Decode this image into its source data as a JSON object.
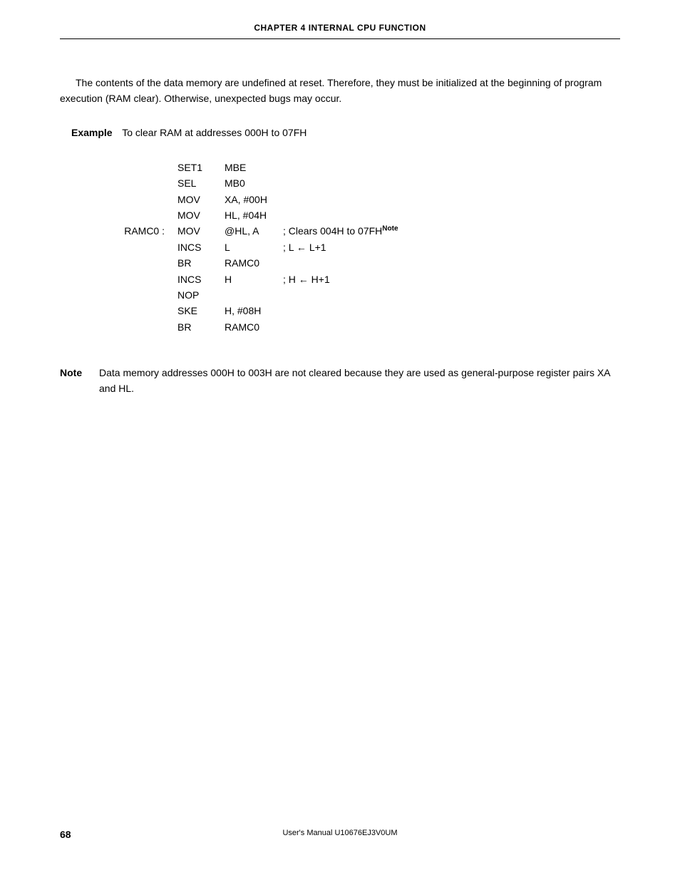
{
  "header": {
    "chapter": "CHAPTER 4   INTERNAL CPU FUNCTION"
  },
  "paragraph1": "The contents of the data memory are undefined at reset.  Therefore, they must be initialized at the beginning of program execution (RAM clear).  Otherwise, unexpected bugs may occur.",
  "example": {
    "label": "Example",
    "text": "To clear RAM at addresses 000H to 07FH"
  },
  "code": {
    "rows": [
      {
        "label": "",
        "op": "SET1",
        "arg": "MBE",
        "comment": ""
      },
      {
        "label": "",
        "op": "SEL",
        "arg": "MB0",
        "comment": ""
      },
      {
        "label": "",
        "op": "MOV",
        "arg": "XA, #00H",
        "comment": ""
      },
      {
        "label": "",
        "op": "MOV",
        "arg": "HL, #04H",
        "comment": ""
      },
      {
        "label": "RAMC0 :",
        "op": "MOV",
        "arg": "@HL, A",
        "comment": "; Clears 004H to 07FH",
        "note_sup": "Note"
      },
      {
        "label": "",
        "op": "INCS",
        "arg": "L",
        "comment": "; L ← L+1"
      },
      {
        "label": "",
        "op": "BR",
        "arg": "RAMC0",
        "comment": ""
      },
      {
        "label": "",
        "op": "INCS",
        "arg": "H",
        "comment": "; H ← H+1"
      },
      {
        "label": "",
        "op": "NOP",
        "arg": "",
        "comment": ""
      },
      {
        "label": "",
        "op": "SKE",
        "arg": "H, #08H",
        "comment": ""
      },
      {
        "label": "",
        "op": "BR",
        "arg": "RAMC0",
        "comment": ""
      }
    ]
  },
  "note": {
    "label": "Note",
    "text": "Data memory addresses 000H to 003H are not cleared because they are used as general-purpose register pairs XA and HL."
  },
  "footer": {
    "page": "68",
    "manual": "User's Manual  U10676EJ3V0UM"
  }
}
